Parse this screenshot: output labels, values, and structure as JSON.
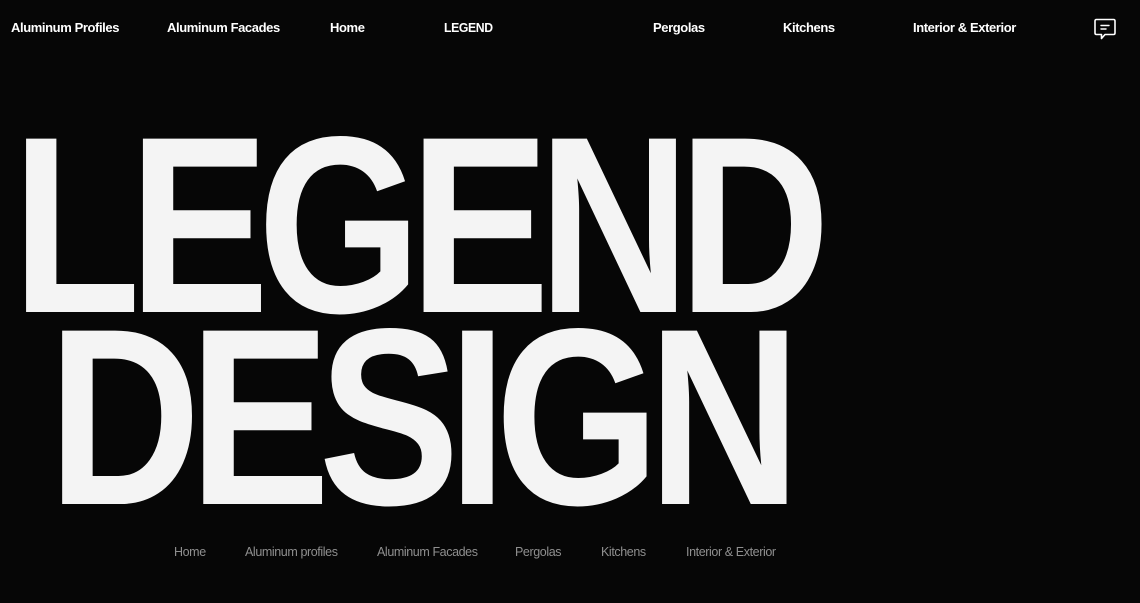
{
  "header": {
    "brand": "LEGEND",
    "brand_color": "#b80b10",
    "nav": [
      {
        "label": "Aluminum Profiles"
      },
      {
        "label": "Aluminum Facades"
      },
      {
        "label": "Home"
      },
      {
        "label": "Pergolas"
      },
      {
        "label": "Kitchens"
      },
      {
        "label": "Interior & Exterior"
      }
    ],
    "chat_icon": "chat-bubble-icon"
  },
  "hero": {
    "line1": "LEGEND",
    "line2": "DESIGN"
  },
  "footer_nav": [
    {
      "label": "Home"
    },
    {
      "label": "Aluminum profiles"
    },
    {
      "label": "Aluminum Facades"
    },
    {
      "label": "Pergolas"
    },
    {
      "label": "Kitchens"
    },
    {
      "label": "Interior & Exterior"
    }
  ],
  "colors": {
    "background": "#060606",
    "text": "#f4f4f4",
    "muted_text": "#8f8f8f"
  }
}
